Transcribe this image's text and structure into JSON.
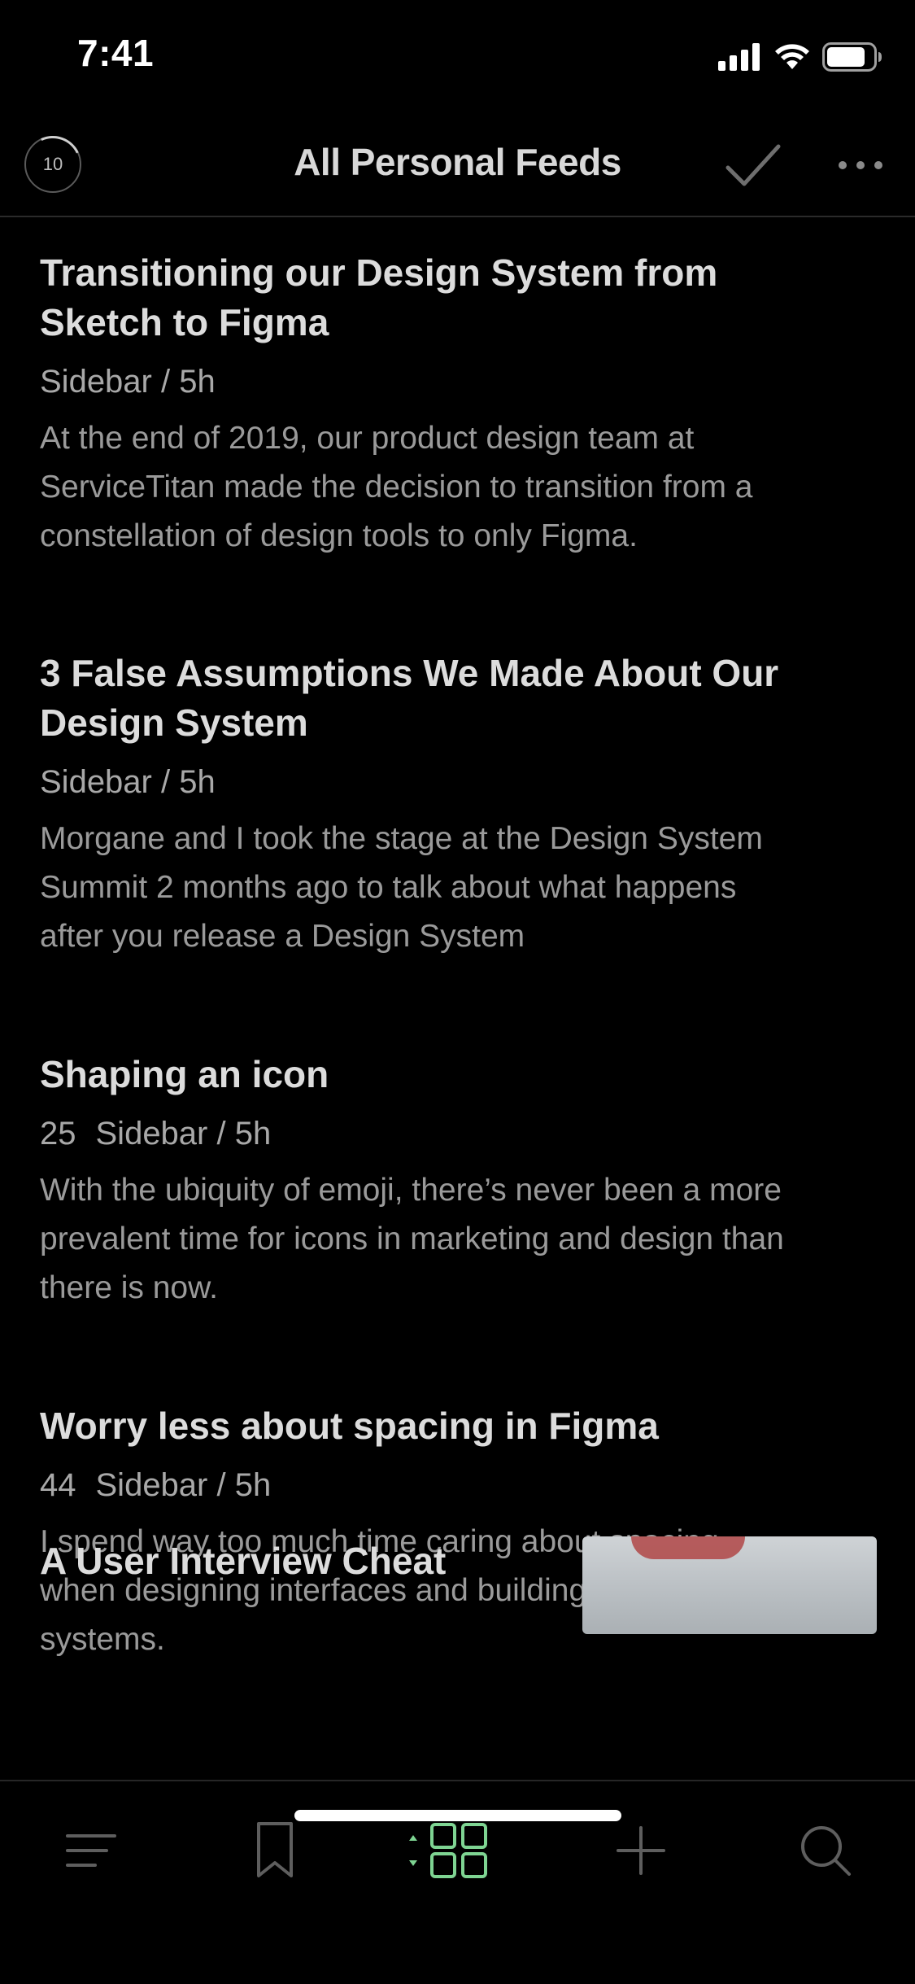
{
  "status_bar": {
    "time": "7:41",
    "icons": [
      "cellular-signal-icon",
      "wifi-icon",
      "battery-icon"
    ]
  },
  "nav": {
    "unread_count": "10",
    "title": "All Personal Feeds",
    "mark_all_read_icon": "checkmark-icon",
    "more_icon": "ellipsis-icon"
  },
  "articles": [
    {
      "title_lines": [
        "Transitioning our Design System from",
        "Sketch to Figma"
      ],
      "count": "",
      "meta": "Sidebar / 5h",
      "excerpt_lines": [
        "At the end of 2019, our product design team at",
        "ServiceTitan made the decision to transition from a",
        "constellation of design tools to only Figma."
      ]
    },
    {
      "title_lines": [
        "3 False Assumptions We Made About Our",
        "Design System"
      ],
      "count": "",
      "meta": "Sidebar / 5h",
      "excerpt_lines": [
        "Morgane and I took the stage at the Design System",
        "Summit 2 months ago to talk about what happens",
        "after you release a Design System"
      ]
    },
    {
      "title_lines": [
        "Shaping an icon"
      ],
      "count": "25",
      "meta": "Sidebar / 5h",
      "excerpt_lines": [
        "With the ubiquity of emoji, there’s never been a more",
        "prevalent time for icons in marketing and design than",
        "there is now."
      ]
    },
    {
      "title_lines": [
        "Worry less about spacing in Figma"
      ],
      "count": "44",
      "meta": "Sidebar / 5h",
      "excerpt_lines": [
        "I spend way too much time caring about spacing",
        "when designing interfaces and building design",
        "systems."
      ]
    }
  ],
  "partial_article": {
    "title": "A User Interview Cheat"
  },
  "tab_bar": {
    "tabs": [
      {
        "icon": "menu-lines-icon",
        "active": false
      },
      {
        "icon": "bookmark-icon",
        "active": false
      },
      {
        "icon": "grid-layout-icon",
        "active": true
      },
      {
        "icon": "plus-icon",
        "active": false
      },
      {
        "icon": "search-icon",
        "active": false
      }
    ],
    "active_color": "#7ed492",
    "inactive_color": "#5e5e5e"
  }
}
